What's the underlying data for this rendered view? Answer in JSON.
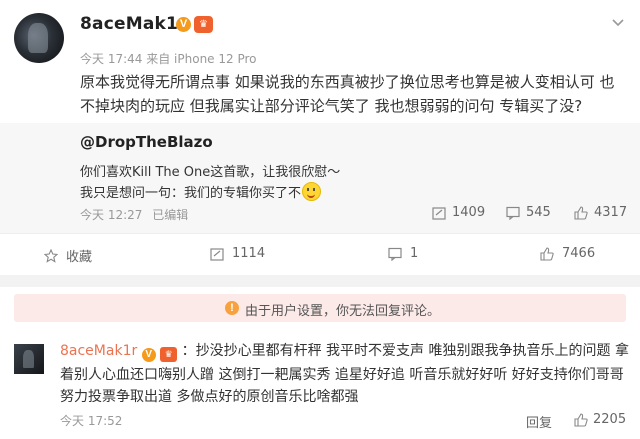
{
  "post": {
    "username": "8aceMak1r",
    "v_badge": "V",
    "level_badge": "♛",
    "time": "今天 17:44",
    "source": "来自 iPhone 12 Pro",
    "content": "原本我觉得无所谓点事 如果说我的东西真被抄了换位思考也算是被人变相认可 也不掉块肉的玩应 但我属实让部分评论气笑了 我也想弱弱的问句 专辑买了没?"
  },
  "quote": {
    "username": "@DropTheBlazo",
    "line1": "你们喜欢Kill The One这首歌，让我很欣慰～",
    "line2": "我只是想问一句：我们的专辑你买了不",
    "time": "今天 12:27",
    "edited": "已编辑",
    "reposts": "1409",
    "comments": "545",
    "likes": "4317"
  },
  "actions": {
    "favorite": "收藏",
    "reposts": "1114",
    "comments": "1",
    "likes": "7466"
  },
  "notice": {
    "icon": "!",
    "text": "由于用户设置，你无法回复评论。"
  },
  "comment": {
    "username": "8aceMak1r",
    "v_badge": "V",
    "level_badge": "♛",
    "text": "：抄没抄心里都有杆秤 我平时不爱支声 唯独别跟我争执音乐上的问题 拿着别人心血还口嗨别人蹭 这倒打一耙属实秀 追星好好追 听音乐就好好听 好好支持你们哥哥努力投票争取出道 多做点好的原创音乐比啥都强",
    "time": "今天 17:52",
    "reply": "回复",
    "likes": "2205"
  },
  "colors": {
    "accent": "#eb7350",
    "v_badge": "#f59a1b",
    "level_badge": "#f0622d",
    "notice_bg": "#fbeae8",
    "quote_bg": "#f7f7f7"
  }
}
